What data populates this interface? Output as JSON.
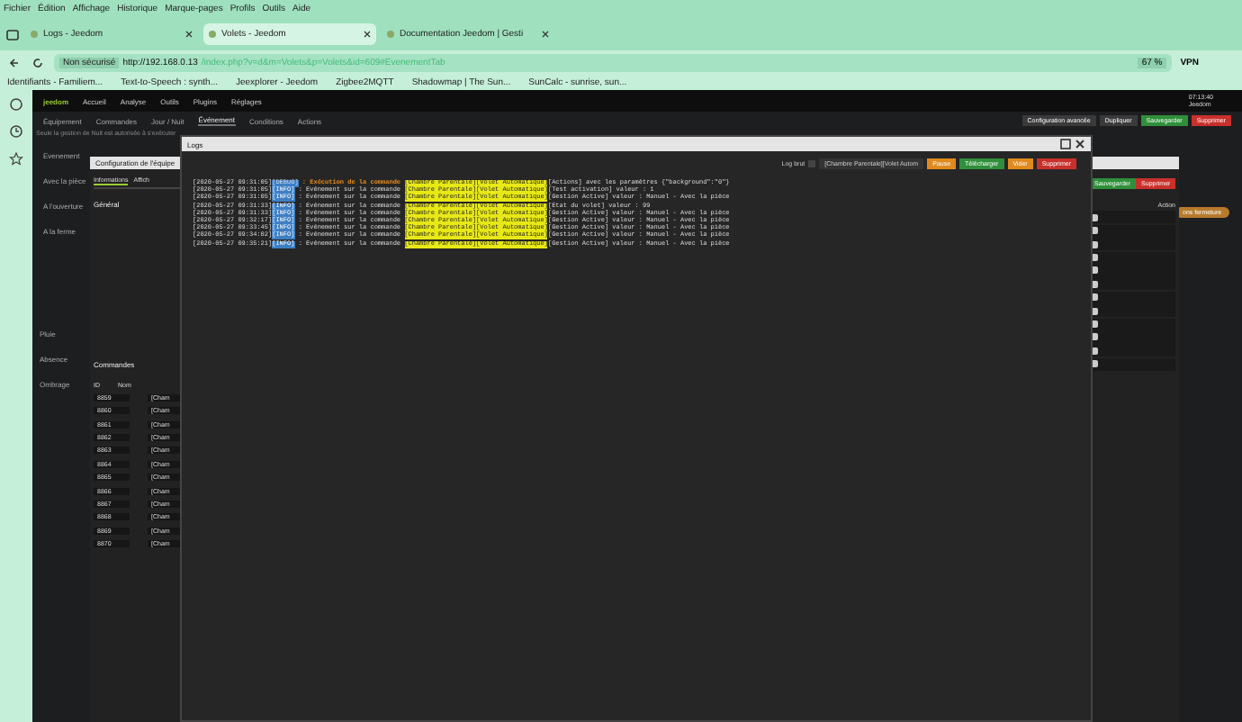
{
  "browser": {
    "menu": [
      "Fichier",
      "Édition",
      "Affichage",
      "Historique",
      "Marque-pages",
      "Profils",
      "Outils",
      "Aide"
    ],
    "tabs": [
      {
        "title": "Logs - Jeedom",
        "selected": false
      },
      {
        "title": "Volets - Jeedom",
        "selected": true
      },
      {
        "title": "Documentation Jeedom | Gesti",
        "selected": false
      }
    ],
    "security": "Non sécurisé",
    "url_host": "http://192.168.0.13",
    "url_path": "/index.php?v=d&m=Volets&p=Volets&id=609#EvenementTab",
    "zoom": "67 %",
    "vpn": "VPN",
    "bookmarks": [
      "Identifiants - Familiem...",
      "Text-to-Speech : synth...",
      "Jeexplorer - Jeedom",
      "Zigbee2MQTT",
      "Shadowmap | The Sun...",
      "SunCalc - sunrise, sun..."
    ]
  },
  "jeedom": {
    "logo": "jeedom",
    "menu": [
      "Accueil",
      "Analyse",
      "Outils",
      "Plugins",
      "Réglages"
    ],
    "clock": "07:13:40",
    "host": "Jeedom",
    "tabs": [
      {
        "label": "Équipement",
        "selected": false
      },
      {
        "label": "Commandes",
        "selected": false
      },
      {
        "label": "Jour / Nuit",
        "selected": false
      },
      {
        "label": "Événement",
        "selected": true
      },
      {
        "label": "Conditions",
        "selected": false
      },
      {
        "label": "Actions",
        "selected": false
      }
    ],
    "actions": [
      {
        "label": "Configuration avancée",
        "kind": "default"
      },
      {
        "label": "Dupliquer",
        "kind": "default"
      },
      {
        "label": "Sauvegarder",
        "kind": "success"
      },
      {
        "label": "Supprimer",
        "kind": "danger"
      }
    ],
    "notice": "Seule la gestion de Nuit est autorisée à s'exécuter",
    "labels_top": [
      "Evenement",
      "Avec la pièce",
      "A l'ouverture",
      "A la ferme"
    ],
    "labels_bottom": [
      "Pluie",
      "Absence",
      "Ombrage"
    ],
    "side_button": "ons fermeture"
  },
  "config_modal": {
    "title": "Configuration de l'équipe",
    "tabs": [
      {
        "label": "Informations",
        "selected": true
      },
      {
        "label": "Affich",
        "selected": false
      }
    ],
    "section": "Général",
    "buttons": [
      {
        "label": "Sauvegarder",
        "kind": "success"
      },
      {
        "label": "Supprimer",
        "kind": "danger"
      }
    ],
    "commands_title": "Commandes",
    "columns": [
      "ID",
      "Nom",
      "Action"
    ],
    "rows": [
      {
        "id": "8859",
        "name": "[Cham"
      },
      {
        "id": "8860",
        "name": "[Cham"
      },
      {
        "id": "8861",
        "name": "[Cham"
      },
      {
        "id": "8862",
        "name": "[Cham"
      },
      {
        "id": "8863",
        "name": "[Cham"
      },
      {
        "id": "8864",
        "name": "[Cham"
      },
      {
        "id": "8865",
        "name": "[Cham"
      },
      {
        "id": "8866",
        "name": "[Cham"
      },
      {
        "id": "8867",
        "name": "[Cham"
      },
      {
        "id": "8868",
        "name": "[Cham"
      },
      {
        "id": "8869",
        "name": "[Cham"
      },
      {
        "id": "8870",
        "name": "[Cham"
      }
    ]
  },
  "logs_modal": {
    "title": "Logs",
    "raw_label": "Log brut",
    "raw_checked": false,
    "log_select": "[Chambre Parentale][Volet Autom",
    "buttons": [
      {
        "label": "Pause",
        "kind": "warning"
      },
      {
        "label": "Télécharger",
        "kind": "success"
      },
      {
        "label": "Vider",
        "kind": "warning"
      },
      {
        "label": "Supprimer",
        "kind": "danger"
      }
    ],
    "lines": [
      {
        "time": "[2020-05-27 09:31:05]",
        "level": "[DEBUG]",
        "message": " : Exécution de la commande",
        "command": "[Chambre Parentale][Volet Automatique]",
        "detail": "[Actions] avec les paramètres {\"background\":\"0\"}",
        "kind": "exec"
      },
      {
        "time": "[2020-05-27 09:31:05]",
        "level": "[INFO]",
        "message": " : Evénement sur la commande",
        "command": "[Chambre Parentale][Volet Automatique]",
        "detail": "[Test activation] valeur : 1",
        "kind": "event"
      },
      {
        "time": "[2020-05-27 09:31:05]",
        "level": "[INFO]",
        "message": " : Evénement sur la commande",
        "command": "[Chambre Parentale][Volet Automatique]",
        "detail": "[Gestion Active] valeur : Manuel - Avec la pièce",
        "kind": "event"
      },
      {
        "time": "[2020-05-27 09:31:33]",
        "level": "[INFO]",
        "message": " : Evénement sur la commande",
        "command": "[Chambre Parentale][Volet Automatique]",
        "detail": "[Etat du volet] valeur : 99",
        "kind": "event"
      },
      {
        "time": "[2020-05-27 09:31:33]",
        "level": "[INFO]",
        "message": " : Evénement sur la commande",
        "command": "[Chambre Parentale][Volet Automatique]",
        "detail": "[Gestion Active] valeur : Manuel - Avec la pièce",
        "kind": "event"
      },
      {
        "time": "[2020-05-27 09:32:17]",
        "level": "[INFO]",
        "message": " : Evénement sur la commande",
        "command": "[Chambre Parentale][Volet Automatique]",
        "detail": "[Gestion Active] valeur : Manuel - Avec la pièce",
        "kind": "event"
      },
      {
        "time": "[2020-05-27 09:33:45]",
        "level": "[INFO]",
        "message": " : Evénement sur la commande",
        "command": "[Chambre Parentale][Volet Automatique]",
        "detail": "[Gestion Active] valeur : Manuel - Avec la pièce",
        "kind": "event"
      },
      {
        "time": "[2020-05-27 09:34:02]",
        "level": "[INFO]",
        "message": " : Evénement sur la commande",
        "command": "[Chambre Parentale][Volet Automatique]",
        "detail": "[Gestion Active] valeur : Manuel - Avec la pièce",
        "kind": "event"
      },
      {
        "time": "[2020-05-27 09:35:21]",
        "level": "[INFO]",
        "message": " : Evénement sur la commande",
        "command": "[Chambre Parentale][Volet Automatique]",
        "detail": "[Gestion Active] valeur : Manuel - Avec la pièce",
        "kind": "event"
      }
    ]
  }
}
